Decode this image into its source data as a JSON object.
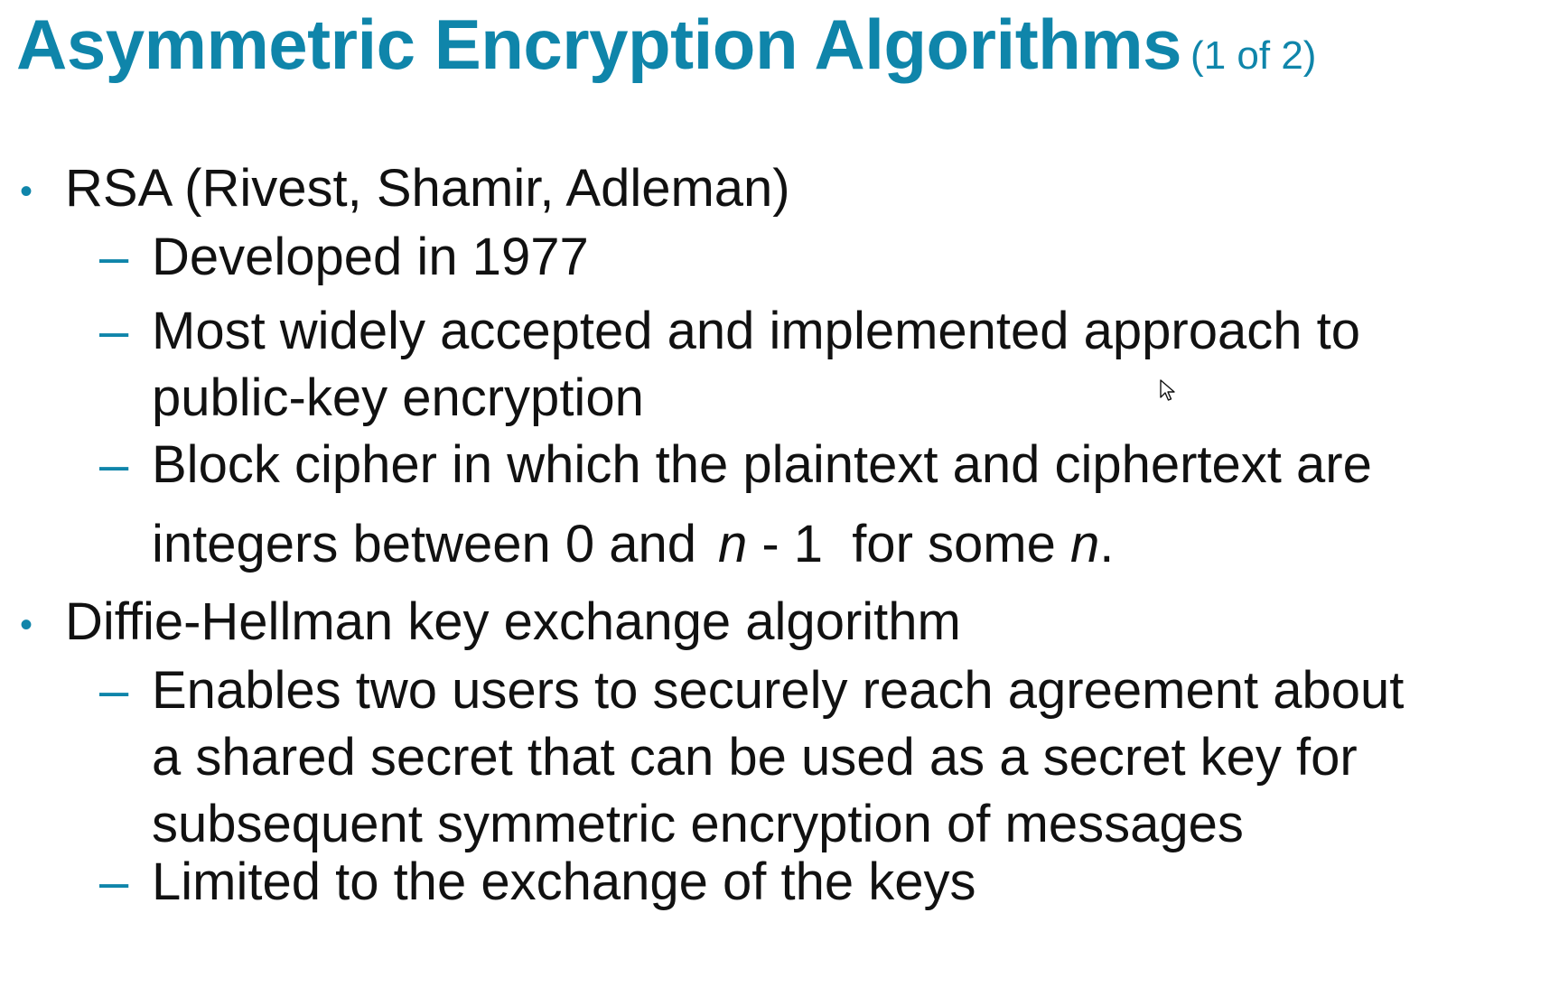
{
  "title": {
    "main": "Asymmetric Encryption Algorithms",
    "sub": "(1 of 2)"
  },
  "bullets": [
    {
      "text": "RSA (Rivest, Shamir, Adleman)",
      "sub": [
        {
          "lines": [
            "Developed in 1977"
          ]
        },
        {
          "lines": [
            "Most widely accepted and implemented approach to",
            "public-key encryption"
          ]
        },
        {
          "line1": "Block cipher in which the plaintext and ciphertext are",
          "line2_pre": "integers between 0 and",
          "line2_var1": "n",
          "line2_op": " - 1",
          "line2_mid": " for some ",
          "line2_var2": "n",
          "line2_end": "."
        }
      ]
    },
    {
      "text": "Diffie-Hellman key exchange algorithm",
      "sub": [
        {
          "lines": [
            "Enables two users to securely reach agreement about",
            "a shared secret that can be used as a secret key for",
            "subsequent symmetric encryption of messages"
          ]
        },
        {
          "lines": [
            "Limited to the exchange of the keys"
          ]
        }
      ]
    }
  ],
  "colors": {
    "accent": "#0f85aa",
    "text": "#111111"
  },
  "icons": {
    "bullet": "bullet-dot-icon",
    "subbullet": "dash-icon",
    "cursor": "mouse-pointer-icon"
  }
}
